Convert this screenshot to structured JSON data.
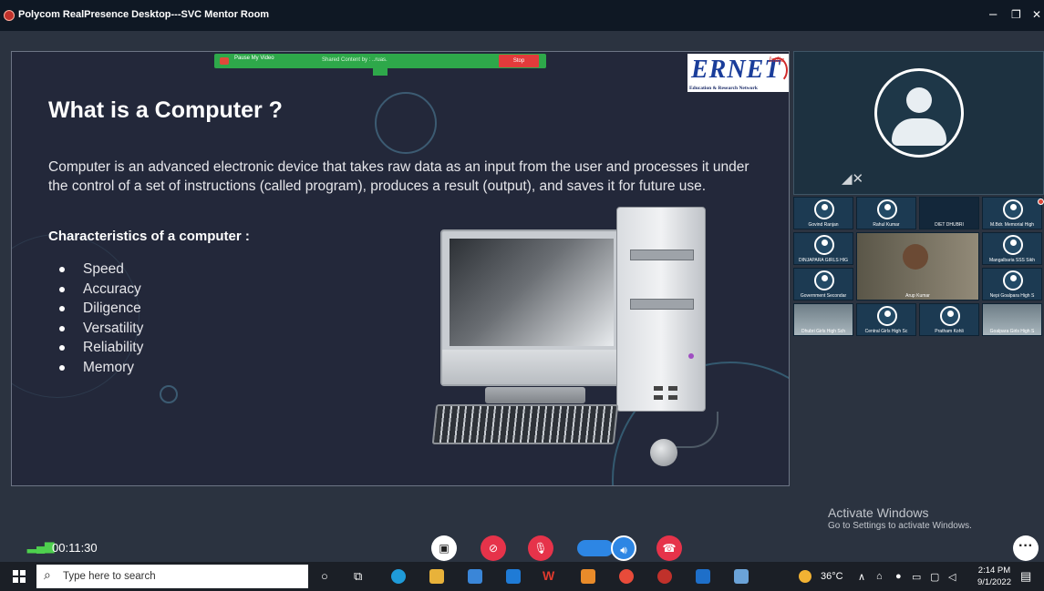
{
  "window": {
    "title": "Polycom RealPresence Desktop---SVC Mentor Room",
    "minimize": "–",
    "restore": "❐",
    "close": "✕"
  },
  "share_bar": {
    "pause_label": "Pause My Video",
    "shared_label": "Shared Content by : ..ruas.",
    "stop_label": "Stop"
  },
  "ernet": {
    "name": "ERNET",
    "country": "India",
    "tagline": "Education & Research Network"
  },
  "slide": {
    "title": "What is a Computer ?",
    "body": "Computer is an advanced electronic device that takes raw data as an input from the user and processes it under the control of a set of instructions (called program), produces a result (output), and saves it for future use.",
    "characteristics_heading": "Characteristics of a computer :",
    "characteristics": [
      "Speed",
      "Accuracy",
      "Diligence",
      "Versatility",
      "Reliability",
      "Memory"
    ]
  },
  "participants": [
    {
      "label": "Govind Ranjan",
      "kind": "avatar"
    },
    {
      "label": "Rahul Kumar",
      "kind": "avatar"
    },
    {
      "label": "DIET DHUBRI",
      "kind": "dark"
    },
    {
      "label": "M.Bdr. Memorial High",
      "kind": "avatar"
    },
    {
      "label": "DINJAPARA GIRLS HIG",
      "kind": "avatar"
    },
    {
      "label": "Arup Kumar",
      "kind": "person"
    },
    {
      "label": "Mangalbaria SSS Sikh",
      "kind": "avatar"
    },
    {
      "label": "Government Secondar",
      "kind": "avatar"
    },
    {
      "label": "Nepi Goalpara High S",
      "kind": "avatar"
    },
    {
      "label": "Dhubri Girls High Sch",
      "kind": "photo"
    },
    {
      "label": "Central Girls High Sc",
      "kind": "avatar"
    },
    {
      "label": "Pratham Kohli",
      "kind": "avatar"
    },
    {
      "label": "Goalpara Girls High S",
      "kind": "photo"
    }
  ],
  "call": {
    "timer": "00:11:30",
    "signal_icon": "signal-bars-icon"
  },
  "watermark": {
    "line1": "Activate Windows",
    "line2": "Go to Settings to activate Windows."
  },
  "taskbar": {
    "search_placeholder": "Type here to search",
    "weather": "36°C",
    "time": "2:14 PM",
    "date": "9/1/2022"
  },
  "colors": {
    "accent_blue": "#2d86e4",
    "danger_red": "#e6334a",
    "share_green": "#2ea84a"
  }
}
